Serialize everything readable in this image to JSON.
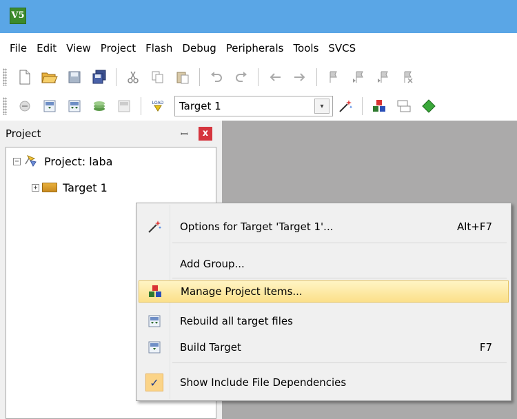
{
  "app": {
    "icon_text": "V5"
  },
  "menubar": {
    "items": [
      "File",
      "Edit",
      "View",
      "Project",
      "Flash",
      "Debug",
      "Peripherals",
      "Tools",
      "SVCS"
    ]
  },
  "toolbar2": {
    "load_label": "LOAD",
    "target_value": "Target 1",
    "dropdown_glyph": "▾"
  },
  "panel": {
    "title": "Project",
    "pin_glyph": "ꟷ",
    "close_glyph": "x"
  },
  "tree": {
    "project_label": "Project: laba",
    "target_label": "Target 1",
    "collapse_glyph": "−",
    "expand_glyph": "+"
  },
  "context_menu": {
    "items": [
      {
        "label": "Options for Target 'Target 1'...",
        "shortcut": "Alt+F7",
        "icon": "magic-wand-icon"
      },
      {
        "label": "Add Group...",
        "shortcut": "",
        "icon": ""
      },
      {
        "label": "Manage Project Items...",
        "shortcut": "",
        "icon": "components-icon",
        "highlighted": true
      },
      {
        "label": "Rebuild all target files",
        "shortcut": "",
        "icon": "rebuild-icon"
      },
      {
        "label": "Build Target",
        "shortcut": "F7",
        "icon": "build-icon"
      },
      {
        "label": "Show Include File Dependencies",
        "shortcut": "",
        "icon": "checkmark-icon",
        "checked": true
      }
    ],
    "check_glyph": "✓"
  },
  "colors": {
    "titlebar": "#5aa6e6",
    "workspace": "#abaaaa",
    "highlight": "#fbe08a",
    "close": "#d5353e"
  }
}
